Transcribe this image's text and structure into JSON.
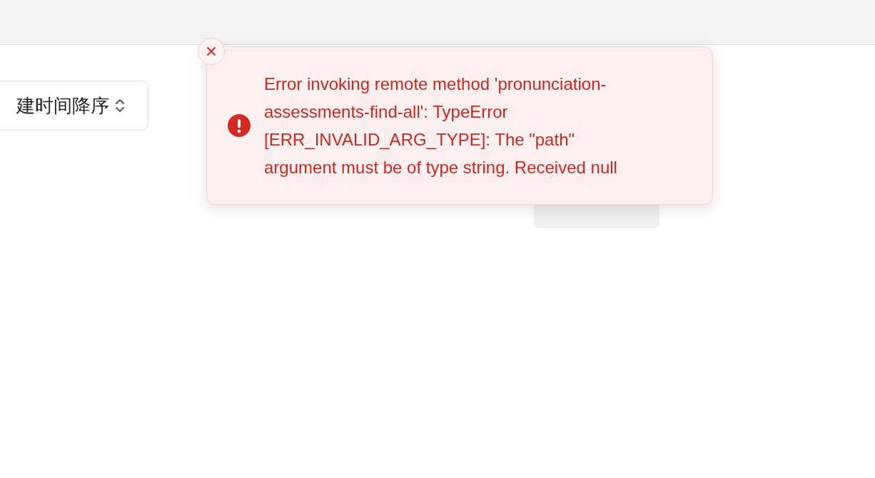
{
  "sort_select": {
    "value": "建时间降序"
  },
  "toast": {
    "kind": "error",
    "message": "Error invoking remote method 'pronunciation-assessments-find-all': TypeError [ERR_INVALID_ARG_TYPE]: The \"path\" argument must be of type string. Received null"
  }
}
